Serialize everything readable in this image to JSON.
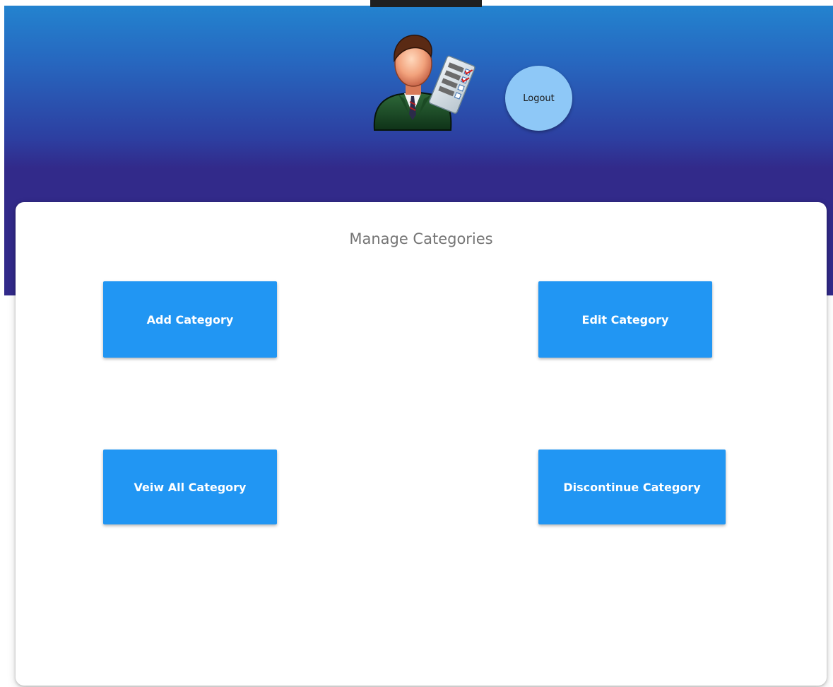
{
  "header": {
    "logout_label": "Logout",
    "avatar_icon": "manager-checklist-icon"
  },
  "main": {
    "title": "Manage Categories",
    "actions": [
      {
        "label": "Add Category"
      },
      {
        "label": "Edit Category"
      },
      {
        "label": "Veiw All Category"
      },
      {
        "label": "Discontinue Category"
      }
    ]
  },
  "colors": {
    "header_top": "#2383cf",
    "header_bottom": "#322a8a",
    "action_button": "#2196f3",
    "logout_button": "#8ec8f7",
    "title_text": "#757575"
  }
}
